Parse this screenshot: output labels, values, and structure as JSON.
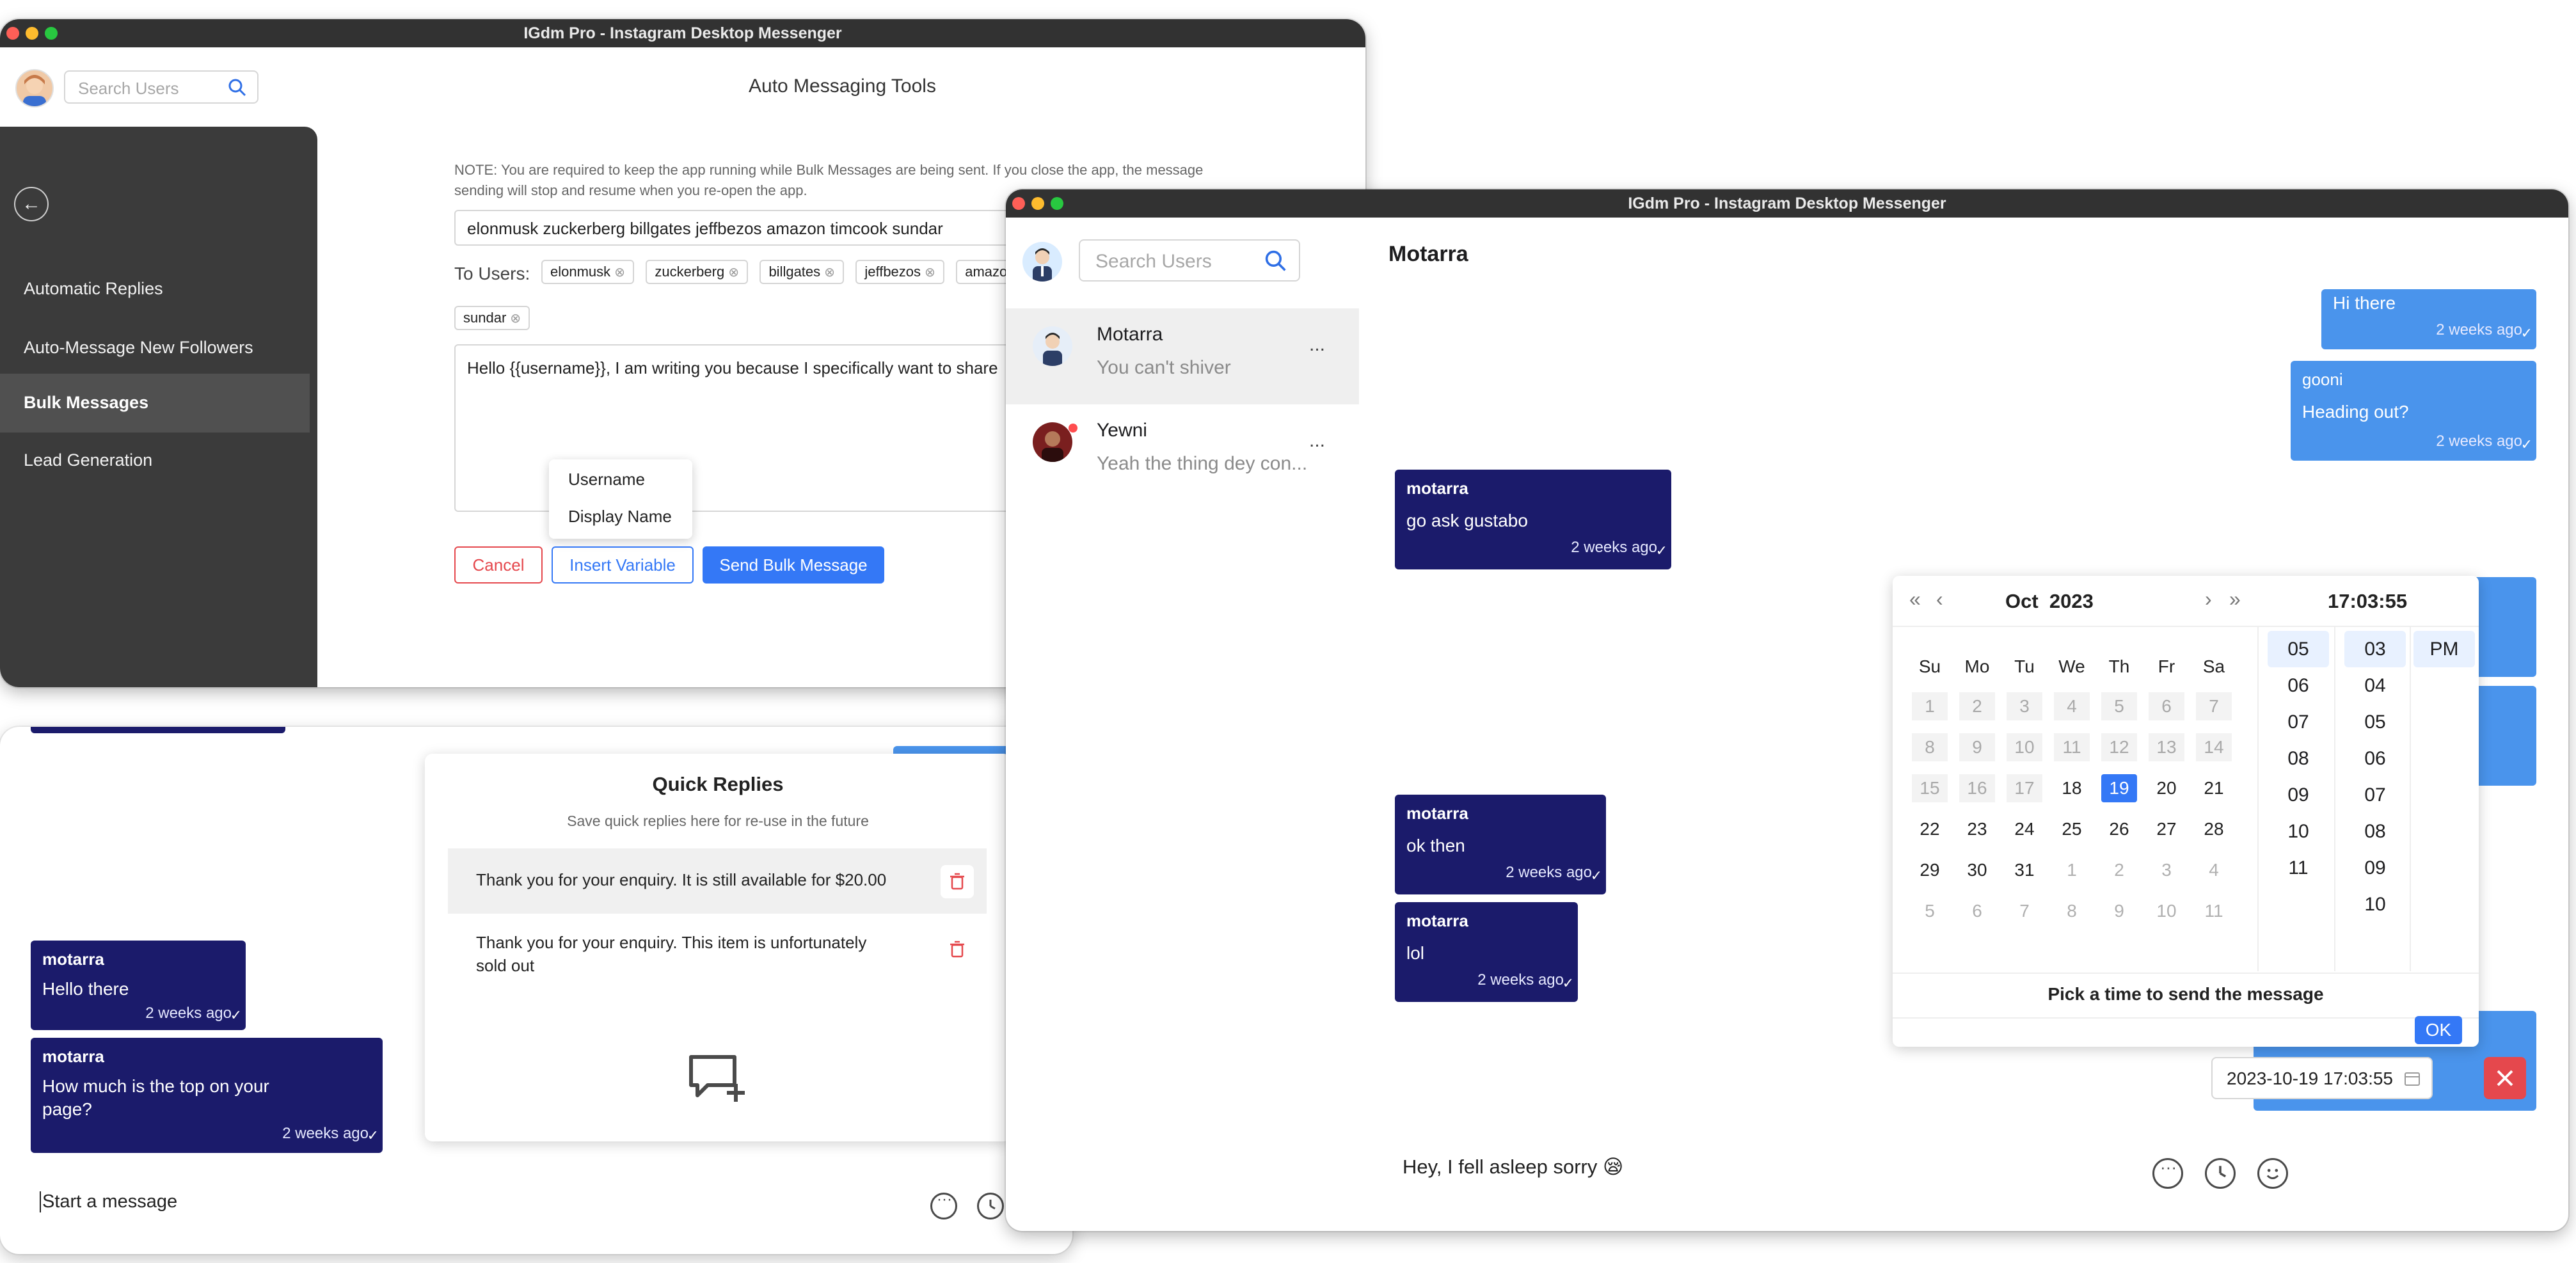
{
  "window1": {
    "title": "IGdm Pro - Instagram Desktop Messenger",
    "search_placeholder": "Search Users",
    "page_title": "Auto Messaging Tools",
    "sidebar": {
      "items": [
        {
          "label": "Automatic Replies"
        },
        {
          "label": "Auto-Message New Followers"
        },
        {
          "label": "Bulk Messages"
        },
        {
          "label": "Lead Generation"
        }
      ]
    },
    "note": "NOTE: You are required to keep the app running while Bulk Messages are being sent. If you close the app, the message sending will stop and resume when you re-open the app.",
    "users_input_value": "elonmusk zuckerberg billgates jeffbezos amazon timcook sundar",
    "to_users_label": "To Users:",
    "chips": [
      "elonmusk",
      "zuckerberg",
      "billgates",
      "jeffbezos",
      "amazo",
      "sundar"
    ],
    "message_text": "Hello  {{username}}, I am writing you because I specifically want to share",
    "variable_menu": [
      "Username",
      "Display Name"
    ],
    "buttons": {
      "cancel": "Cancel",
      "insert_variable": "Insert Variable",
      "send": "Send Bulk Message"
    }
  },
  "window2": {
    "chat_messages": [
      {
        "name": "motarra",
        "text": "Hello there",
        "time": "2 weeks ago"
      },
      {
        "name": "motarra",
        "text_line1": "How much is the top on your",
        "text_line2": "page?",
        "time": "2 weeks ago"
      }
    ],
    "quick_replies": {
      "title": "Quick Replies",
      "subtitle": "Save quick replies here for re-use in the future",
      "items": [
        {
          "text": "Thank you for your enquiry. It is still available for $20.00"
        },
        {
          "text_line1": "Thank you for your enquiry. This item is unfortunately",
          "text_line2": "sold out"
        }
      ]
    },
    "composer_placeholder": "Start a message"
  },
  "window3": {
    "title": "IGdm Pro - Instagram Desktop Messenger",
    "search_placeholder": "Search Users",
    "conversations": [
      {
        "name": "Motarra",
        "preview": "You can't shiver",
        "more": "..."
      },
      {
        "name": "Yewni",
        "preview": "Yeah the thing dey con...",
        "more": "..."
      }
    ],
    "chat_header": "Motarra",
    "messages": [
      {
        "type": "out",
        "text": "Hi there",
        "time": "2 weeks ago"
      },
      {
        "type": "out",
        "name": "gooni",
        "text": "Heading out?",
        "time": "2 weeks ago"
      },
      {
        "type": "in",
        "name": "motarra",
        "text": "go ask gustabo",
        "time": "2 weeks ago"
      },
      {
        "type": "in",
        "name": "motarra",
        "text": "ok then",
        "time": "2 weeks ago"
      },
      {
        "type": "in",
        "name": "motarra",
        "text": "lol",
        "time": "2 weeks ago"
      }
    ],
    "picker": {
      "month": "Oct",
      "year": "2023",
      "time_display": "17:03:55",
      "weekdays": [
        "Su",
        "Mo",
        "Tu",
        "We",
        "Th",
        "Fr",
        "Sa"
      ],
      "weeks": [
        [
          "1",
          "2",
          "3",
          "4",
          "5",
          "6",
          "7"
        ],
        [
          "8",
          "9",
          "10",
          "11",
          "12",
          "13",
          "14"
        ],
        [
          "15",
          "16",
          "17",
          "18",
          "19",
          "20",
          "21"
        ],
        [
          "22",
          "23",
          "24",
          "25",
          "26",
          "27",
          "28"
        ],
        [
          "29",
          "30",
          "31",
          "1",
          "2",
          "3",
          "4"
        ],
        [
          "5",
          "6",
          "7",
          "8",
          "9",
          "10",
          "11"
        ]
      ],
      "selected_day": "19",
      "hours": [
        "05",
        "06",
        "07",
        "08",
        "09",
        "10",
        "11"
      ],
      "minutes": [
        "03",
        "04",
        "05",
        "06",
        "07",
        "08",
        "09",
        "10"
      ],
      "meridiem": "PM",
      "caption": "Pick a time to send the message",
      "ok": "OK"
    },
    "datetime_value": "2023-10-19 17:03:55",
    "composer_text": "Hey, I fell asleep sorry 😪"
  },
  "colors": {
    "accent": "#3478f6",
    "incoming": "#1b1b6b",
    "outgoing": "#4a94ec",
    "danger": "#e5484d"
  }
}
